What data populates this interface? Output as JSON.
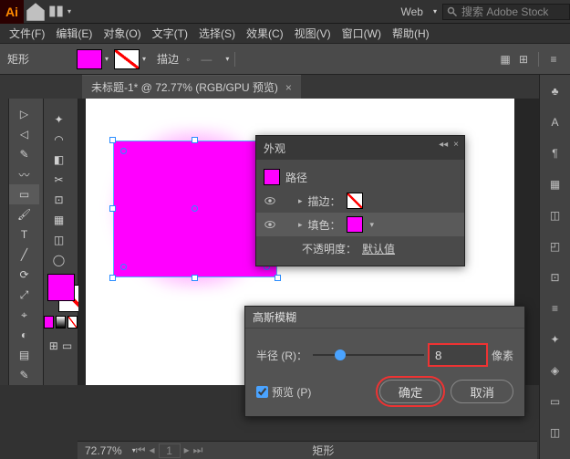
{
  "topbar": {
    "logo": "Ai",
    "doc_preset": "Web",
    "search_placeholder": "搜索 Adobe Stock"
  },
  "menu": [
    "文件(F)",
    "编辑(E)",
    "对象(O)",
    "文字(T)",
    "选择(S)",
    "效果(C)",
    "视图(V)",
    "窗口(W)",
    "帮助(H)"
  ],
  "control": {
    "shape": "矩形",
    "stroke_label": "描边",
    "stroke_dash": "—"
  },
  "tab": {
    "title": "未标题-1* @ 72.77% (RGB/GPU 预览)"
  },
  "appearance": {
    "title": "外观",
    "path": "路径",
    "stroke": "描边：",
    "fill": "填色：",
    "opacity": "不透明度：",
    "opacity_val": "默认值"
  },
  "gauss": {
    "title": "高斯模糊",
    "radius_label": "半径 (R)：",
    "radius_value": "8",
    "unit": "像素",
    "preview": "预览 (P)",
    "ok": "确定",
    "cancel": "取消"
  },
  "status": {
    "zoom": "72.77%",
    "shape": "矩形"
  }
}
